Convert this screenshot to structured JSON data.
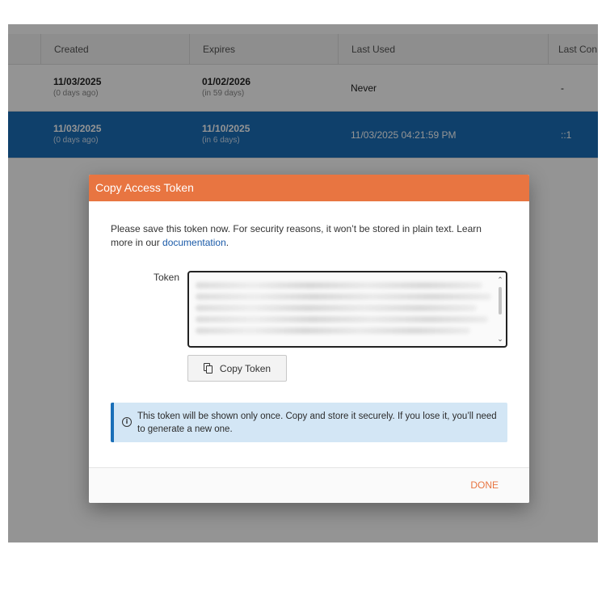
{
  "table": {
    "columns": [
      "Created",
      "Expires",
      "Last Used",
      "Last Con"
    ],
    "rows": [
      {
        "created": "11/03/2025",
        "created_sub": "(0 days ago)",
        "expires": "01/02/2026",
        "expires_sub": "(in 59 days)",
        "last_used": "Never",
        "last_con": "-"
      },
      {
        "created": "11/03/2025",
        "created_sub": "(0 days ago)",
        "expires": "11/10/2025",
        "expires_sub": "(in 6 days)",
        "last_used": "11/03/2025 04:21:59 PM",
        "last_con": "::1"
      }
    ]
  },
  "dialog": {
    "title": "Copy Access Token",
    "intro_before_link": "Please save this token now. For security reasons, it won’t be stored in plain text. Learn more in our ",
    "link_text": "documentation",
    "intro_after_link": ".",
    "token_label": "Token",
    "copy_button_label": "Copy Token",
    "notice_text": "This token will be shown only once. Copy and store it securely. If you lose it, you’ll need to generate a new one.",
    "notice_icon_glyph": "i",
    "done_label": "DONE",
    "header_color": "#e87541",
    "accent_color": "#1a6fb8"
  }
}
